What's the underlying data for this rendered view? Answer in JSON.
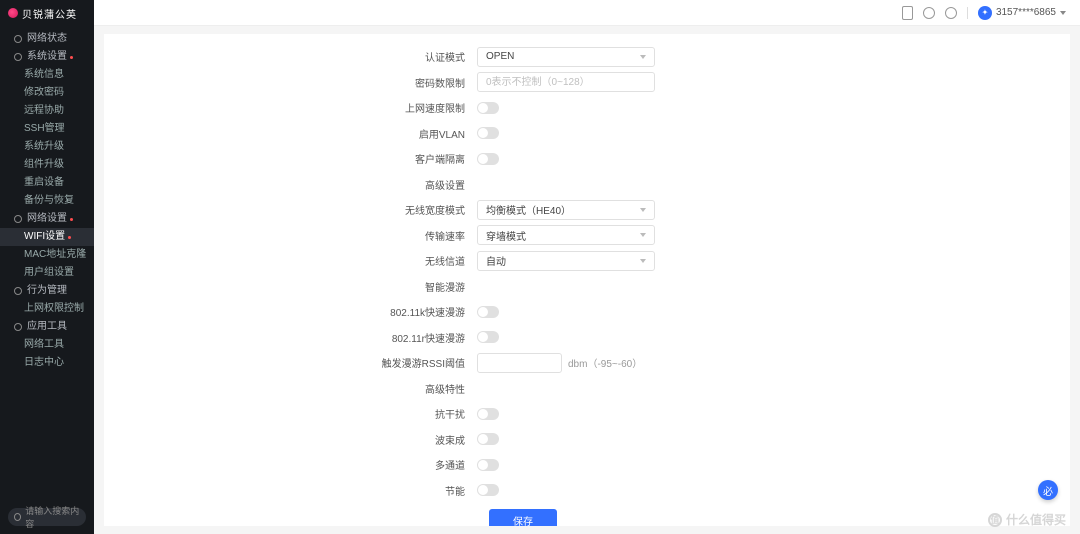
{
  "brand": {
    "name": "贝锐蒲公英"
  },
  "topbar": {
    "user_id": "3157****6865"
  },
  "sidebar": {
    "items": [
      {
        "label": "网络状态",
        "type": "top"
      },
      {
        "label": "系统设置",
        "type": "top",
        "dot": true
      },
      {
        "label": "系统信息",
        "type": "sub"
      },
      {
        "label": "修改密码",
        "type": "sub"
      },
      {
        "label": "远程协助",
        "type": "sub"
      },
      {
        "label": "SSH管理",
        "type": "sub"
      },
      {
        "label": "系统升级",
        "type": "sub"
      },
      {
        "label": "组件升级",
        "type": "sub"
      },
      {
        "label": "重启设备",
        "type": "sub"
      },
      {
        "label": "备份与恢复",
        "type": "sub"
      },
      {
        "label": "网络设置",
        "type": "top",
        "dot": true
      },
      {
        "label": "WIFI设置",
        "type": "sub",
        "active": true,
        "dot": true
      },
      {
        "label": "MAC地址克隆",
        "type": "sub"
      },
      {
        "label": "用户组设置",
        "type": "sub"
      },
      {
        "label": "行为管理",
        "type": "top"
      },
      {
        "label": "上网权限控制",
        "type": "sub"
      },
      {
        "label": "应用工具",
        "type": "top"
      },
      {
        "label": "网络工具",
        "type": "sub"
      },
      {
        "label": "日志中心",
        "type": "sub"
      }
    ],
    "search_placeholder": "请输入搜索内容"
  },
  "form": {
    "auth_mode": {
      "label": "认证模式",
      "value": "OPEN"
    },
    "pwd_limit": {
      "label": "密码数限制",
      "placeholder": "0表示不控制（0~128）"
    },
    "speed_limit": {
      "label": "上网速度限制"
    },
    "enable_vlan": {
      "label": "启用VLAN"
    },
    "client_isolate": {
      "label": "客户端隔离"
    },
    "advanced": {
      "label": "高级设置"
    },
    "freq_mode": {
      "label": "无线宽度模式",
      "value": "均衡模式（HE40）"
    },
    "bridge_mode": {
      "label": "传输速率",
      "value": "穿墙模式"
    },
    "channel": {
      "label": "无线信道",
      "value": "自动"
    },
    "smart_roam": {
      "label": "智能漫游"
    },
    "r11k": {
      "label": "802.11k快速漫游"
    },
    "r11r": {
      "label": "802.11r快速漫游"
    },
    "rssi": {
      "label": "触发漫游RSSI阈值",
      "hint": "dbm（-95~-60）"
    },
    "adv_feature": {
      "label": "高级特性"
    },
    "anti_interference": {
      "label": "抗干扰"
    },
    "beamforming": {
      "label": "波束成"
    },
    "multi_stream": {
      "label": "多通道"
    },
    "power_save": {
      "label": "节能"
    },
    "save": "保存"
  },
  "watermark": "什么值得买",
  "fab_text": "必"
}
